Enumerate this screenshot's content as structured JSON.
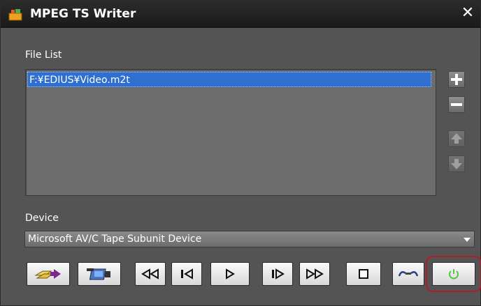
{
  "window": {
    "title": "MPEG TS Writer",
    "close_glyph": "✕"
  },
  "file_list": {
    "label": "File List",
    "items": [
      "F:¥EDIUS¥Video.m2t"
    ]
  },
  "side_buttons": [
    {
      "icon": "plus-icon",
      "enabled": true
    },
    {
      "icon": "minus-icon",
      "enabled": true
    },
    {
      "icon": "arrow-up-icon",
      "enabled": false
    },
    {
      "icon": "arrow-down-icon",
      "enabled": false
    }
  ],
  "device": {
    "label": "Device",
    "selected": "Microsoft AV/C Tape Subunit Device"
  },
  "controls": [
    "load-from-tape-icon",
    "camera-icon",
    "rewind-icon",
    "step-back-icon",
    "play-icon",
    "step-forward-icon",
    "fast-forward-icon",
    "stop-icon",
    "connect-icon",
    "power-icon"
  ],
  "colors": {
    "highlight": "#2f6fd1",
    "power_ring": "#b01d2a",
    "power_icon": "#56c54a"
  }
}
